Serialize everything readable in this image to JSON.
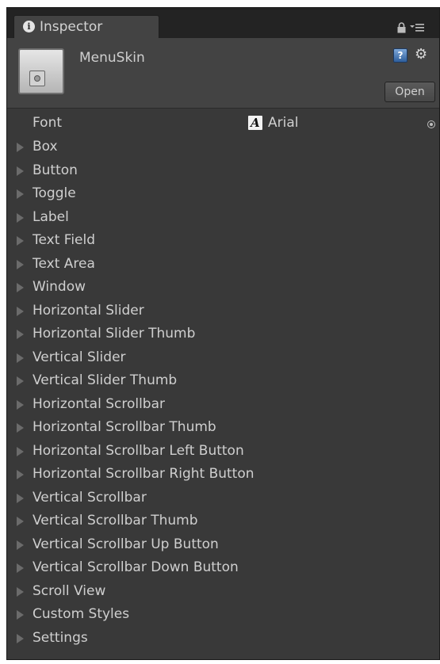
{
  "tab": {
    "title": "Inspector",
    "icon": "info-icon"
  },
  "toolbar": {
    "lock_icon": "lock-icon",
    "menu_icon": "menu-icon"
  },
  "asset": {
    "name": "MenuSkin",
    "help_icon": "help-icon",
    "help_glyph": "?",
    "gear_icon": "gear-icon",
    "gear_glyph": "⚙",
    "open_label": "Open"
  },
  "font_field": {
    "label": "Font",
    "glyph": "A",
    "value": "Arial"
  },
  "styles": [
    "Box",
    "Button",
    "Toggle",
    "Label",
    "Text Field",
    "Text Area",
    "Window",
    "Horizontal Slider",
    "Horizontal Slider Thumb",
    "Vertical Slider",
    "Vertical Slider Thumb",
    "Horizontal Scrollbar",
    "Horizontal Scrollbar Thumb",
    "Horizontal Scrollbar Left Button",
    "Horizontal Scrollbar Right Button",
    "Vertical Scrollbar",
    "Vertical Scrollbar Thumb",
    "Vertical Scrollbar Up Button",
    "Vertical Scrollbar Down Button",
    "Scroll View",
    "Custom Styles",
    "Settings"
  ],
  "colors": {
    "panel": "#393939",
    "header": "#434343",
    "text": "#cfcfcf"
  }
}
